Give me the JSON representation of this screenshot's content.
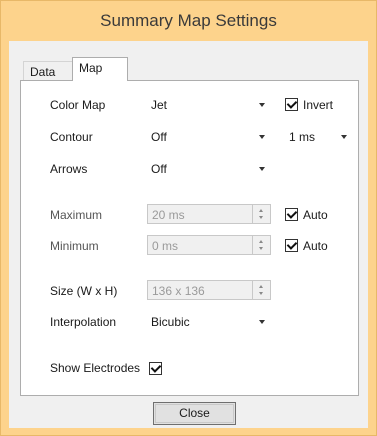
{
  "window": {
    "title": "Summary  Map Settings"
  },
  "tabs": [
    {
      "label": "Data"
    },
    {
      "label": "Map"
    }
  ],
  "map": {
    "color_map": {
      "label": "Color Map",
      "value": "Jet",
      "invert_label": "Invert",
      "invert_checked": true
    },
    "contour": {
      "label": "Contour",
      "value": "Off",
      "interval_value": "1 ms"
    },
    "arrows": {
      "label": "Arrows",
      "value": "Off"
    },
    "maximum": {
      "label": "Maximum",
      "value": "20 ms",
      "auto_label": "Auto",
      "auto_checked": true
    },
    "minimum": {
      "label": "Minimum",
      "value": "0 ms",
      "auto_label": "Auto",
      "auto_checked": true
    },
    "size": {
      "label": "Size (W x H)",
      "value": "136 x 136"
    },
    "interpolation": {
      "label": "Interpolation",
      "value": "Bicubic"
    },
    "show_electrodes": {
      "label": "Show Electrodes",
      "checked": true
    }
  },
  "buttons": {
    "close": "Close"
  }
}
